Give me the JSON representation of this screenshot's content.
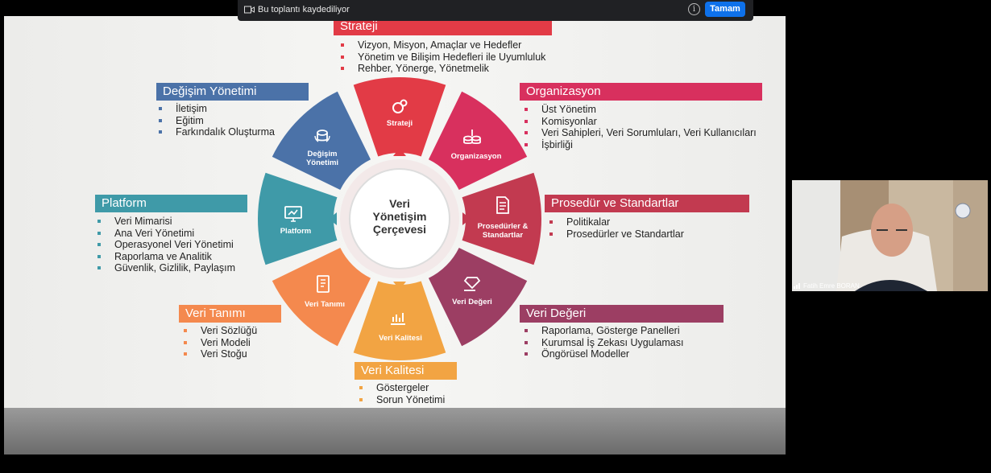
{
  "meeting": {
    "recording_text": "Bu toplantı kaydediliyor",
    "ok_button": "Tamam",
    "info_icon": "i",
    "participant_name": "Fatih Emre BORAN"
  },
  "colors": {
    "strateji": "#e23b46",
    "organizasyon": "#d8305e",
    "prosedur": "#c23a50",
    "veri_degeri": "#9c3e63",
    "veri_kalitesi": "#f2a443",
    "veri_tanimi": "#f4894e",
    "platform": "#3f9aa8",
    "degisim": "#4b72a8"
  },
  "wheel": {
    "center_line1": "Veri",
    "center_line2": "Yönetişim",
    "center_line3": "Çerçevesi",
    "segments": [
      {
        "id": "strateji",
        "line1": "Strateji",
        "line2": ""
      },
      {
        "id": "organizasyon",
        "line1": "Organizasyon",
        "line2": ""
      },
      {
        "id": "prosedur",
        "line1": "Prosedürler &",
        "line2": "Standartlar"
      },
      {
        "id": "veri_degeri",
        "line1": "Veri Değeri",
        "line2": ""
      },
      {
        "id": "veri_kalitesi",
        "line1": "Veri Kalitesi",
        "line2": ""
      },
      {
        "id": "veri_tanimi",
        "line1": "Veri Tanımı",
        "line2": ""
      },
      {
        "id": "platform",
        "line1": "Platform",
        "line2": ""
      },
      {
        "id": "degisim",
        "line1": "Değişim",
        "line2": "Yönetimi"
      }
    ]
  },
  "sections": {
    "strateji": {
      "title": "Strateji",
      "items": [
        "Vizyon, Misyon, Amaçlar ve Hedefler",
        "Yönetim ve Bilişim Hedefleri ile Uyumluluk",
        "Rehber, Yönerge, Yönetmelik"
      ]
    },
    "organizasyon": {
      "title": "Organizasyon",
      "items": [
        "Üst Yönetim",
        "Komisyonlar",
        "Veri Sahipleri, Veri Sorumluları, Veri Kullanıcıları",
        "İşbirliği"
      ]
    },
    "prosedur": {
      "title": "Prosedür ve Standartlar",
      "items": [
        "Politikalar",
        "Prosedürler ve Standartlar"
      ]
    },
    "veri_degeri": {
      "title": "Veri Değeri",
      "items": [
        "Raporlama, Gösterge Panelleri",
        "Kurumsal İş Zekası Uygulaması",
        "Öngörüsel Modeller"
      ]
    },
    "veri_kalitesi": {
      "title": "Veri Kalitesi",
      "items": [
        "Göstergeler",
        "Sorun Yönetimi"
      ]
    },
    "veri_tanimi": {
      "title": "Veri Tanımı",
      "items": [
        "Veri Sözlüğü",
        "Veri Modeli",
        "Veri Stoğu"
      ]
    },
    "platform": {
      "title": "Platform",
      "items": [
        "Veri Mimarisi",
        "Ana Veri Yönetimi",
        "Operasyonel Veri Yönetimi",
        "Raporlama ve Analitik",
        "Güvenlik, Gizlilik, Paylaşım"
      ]
    },
    "degisim": {
      "title": "Değişim Yönetimi",
      "items": [
        "İletişim",
        "Eğitim",
        "Farkındalık Oluşturma"
      ]
    }
  }
}
